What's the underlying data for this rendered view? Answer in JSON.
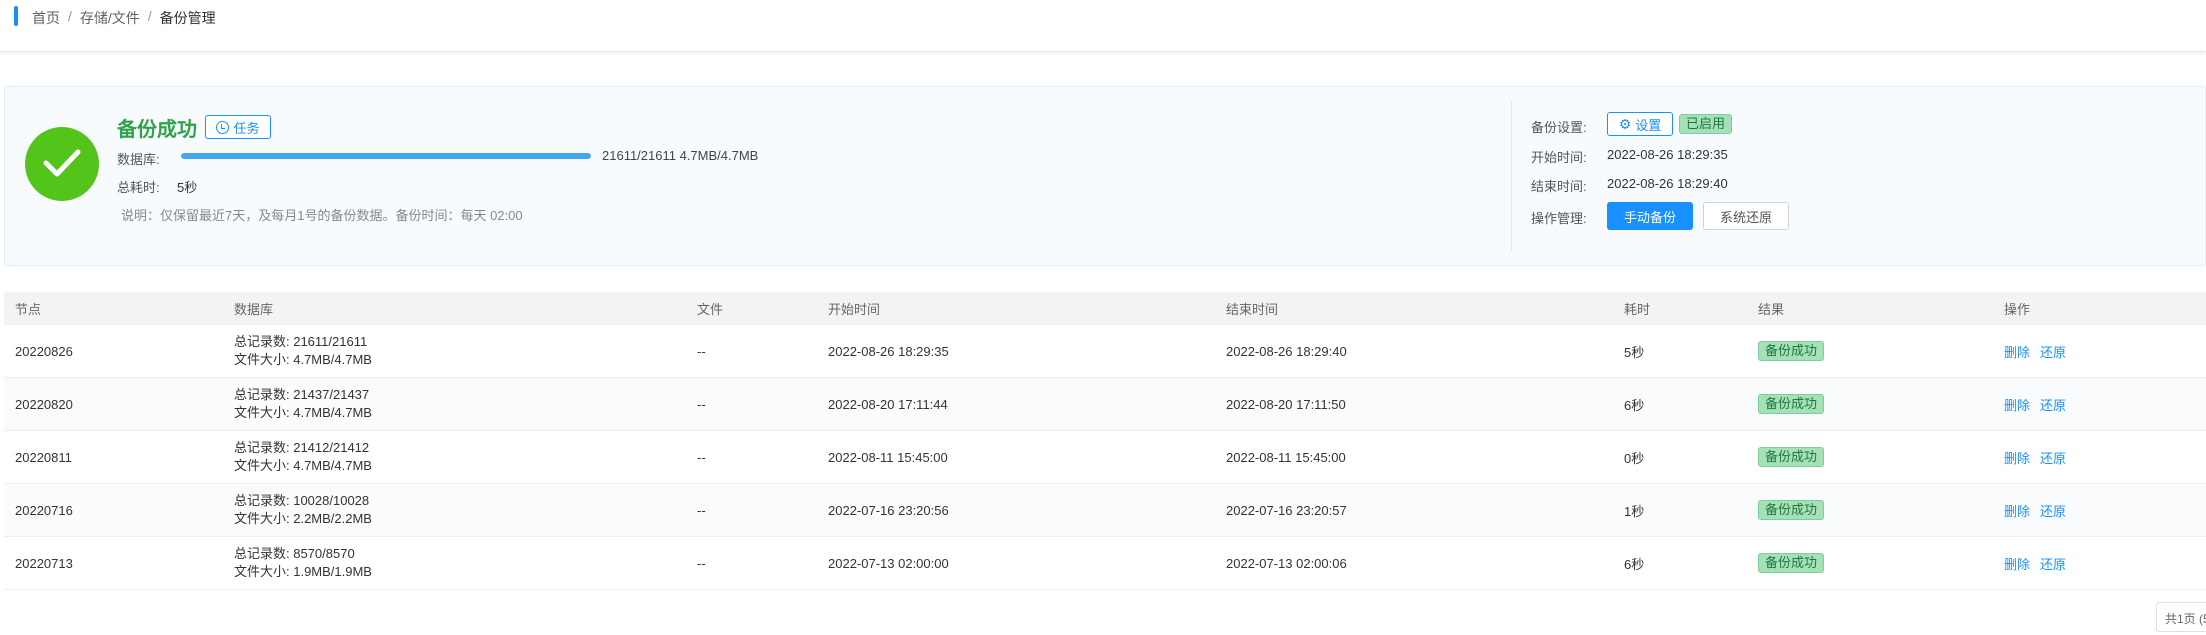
{
  "breadcrumb": {
    "items": [
      "首页",
      "存储/文件"
    ],
    "current": "备份管理"
  },
  "summary": {
    "status_title": "备份成功",
    "task_button": "任务",
    "db_label": "数据库:",
    "progress_fraction": 1.0,
    "progress_text": "21611/21611  4.7MB/4.7MB",
    "time_label": "总耗时:",
    "time_value": "5秒",
    "note": "说明：仅保留最近7天，及每月1号的备份数据。备份时间：每天 02:00",
    "settings_label": "备份设置:",
    "settings_button": "设置",
    "enabled_badge": "已启用",
    "start_label": "开始时间:",
    "start_value": "2022-08-26 18:29:35",
    "end_label": "结束时间:",
    "end_value": "2022-08-26 18:29:40",
    "ops_label": "操作管理:",
    "manual_backup": "手动备份",
    "system_restore": "系统还原",
    "success_color": "#52c41a",
    "accent_color": "#1890ff"
  },
  "table": {
    "headers": [
      "节点",
      "数据库",
      "文件",
      "开始时间",
      "结束时间",
      "耗时",
      "结果",
      "操作"
    ],
    "rows": [
      {
        "node": "20220826",
        "records": "总记录数: 21611/21611",
        "size": "文件大小: 4.7MB/4.7MB",
        "file": "--",
        "start": "2022-08-26 18:29:35",
        "end": "2022-08-26 18:29:40",
        "duration": "5秒",
        "result": "备份成功",
        "delete": "删除",
        "restore": "还原"
      },
      {
        "node": "20220820",
        "records": "总记录数: 21437/21437",
        "size": "文件大小: 4.7MB/4.7MB",
        "file": "--",
        "start": "2022-08-20 17:11:44",
        "end": "2022-08-20 17:11:50",
        "duration": "6秒",
        "result": "备份成功",
        "delete": "删除",
        "restore": "还原"
      },
      {
        "node": "20220811",
        "records": "总记录数: 21412/21412",
        "size": "文件大小: 4.7MB/4.7MB",
        "file": "--",
        "start": "2022-08-11 15:45:00",
        "end": "2022-08-11 15:45:00",
        "duration": "0秒",
        "result": "备份成功",
        "delete": "删除",
        "restore": "还原"
      },
      {
        "node": "20220716",
        "records": "总记录数: 10028/10028",
        "size": "文件大小: 2.2MB/2.2MB",
        "file": "--",
        "start": "2022-07-16 23:20:56",
        "end": "2022-07-16 23:20:57",
        "duration": "1秒",
        "result": "备份成功",
        "delete": "删除",
        "restore": "还原"
      },
      {
        "node": "20220713",
        "records": "总记录数: 8570/8570",
        "size": "文件大小: 1.9MB/1.9MB",
        "file": "--",
        "start": "2022-07-13 02:00:00",
        "end": "2022-07-13 02:00:06",
        "duration": "6秒",
        "result": "备份成功",
        "delete": "删除",
        "restore": "还原"
      }
    ]
  },
  "pager": {
    "text": "共1页 (5"
  }
}
